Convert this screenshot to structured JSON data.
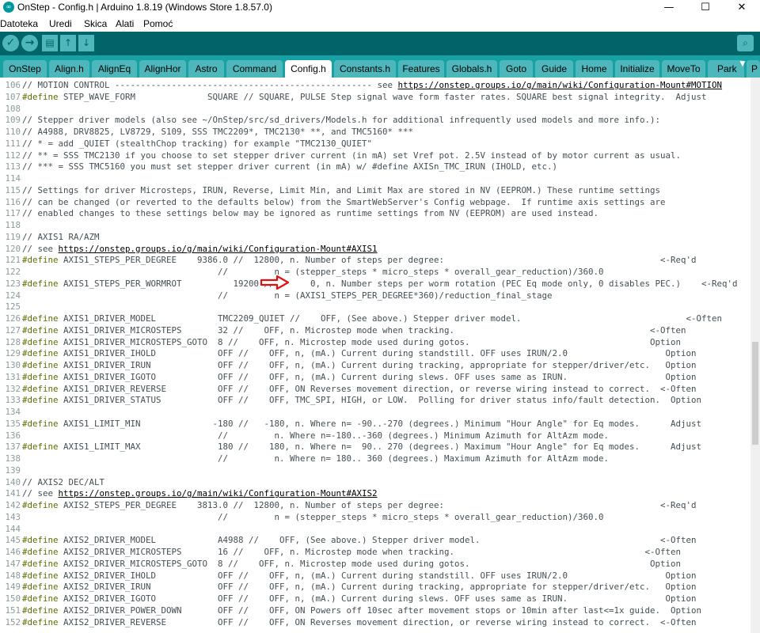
{
  "window": {
    "title": "OnStep - Config.h | Arduino 1.8.19 (Windows Store 1.8.57.0)",
    "app_icon_text": "∞",
    "minimize": "—",
    "maximize": "☐",
    "close": "✕"
  },
  "menu": [
    "Datoteka",
    "Uredi",
    "Skica",
    "Alati",
    "Pomoć"
  ],
  "toolbar": {
    "verify_icon": "✓",
    "upload_icon": "→",
    "new_icon": "▤",
    "open_icon": "↑",
    "save_icon": "↓",
    "serial_icon": "⌕"
  },
  "tabs": [
    {
      "label": "OnStep",
      "active": false
    },
    {
      "label": "Align.h",
      "active": false
    },
    {
      "label": "AlignEq",
      "active": false
    },
    {
      "label": "AlignHor",
      "active": false
    },
    {
      "label": "Astro",
      "active": false
    },
    {
      "label": "Command",
      "active": false
    },
    {
      "label": "Config.h",
      "active": true
    },
    {
      "label": "Constants.h",
      "active": false
    },
    {
      "label": "Features",
      "active": false
    },
    {
      "label": "Globals.h",
      "active": false
    },
    {
      "label": "Goto",
      "active": false
    },
    {
      "label": "Guide",
      "active": false
    },
    {
      "label": "Home",
      "active": false
    },
    {
      "label": "Initialize",
      "active": false
    },
    {
      "label": "MoveTo",
      "active": false
    },
    {
      "label": "Park",
      "active": false
    },
    {
      "label": "P",
      "active": false
    }
  ],
  "tab_menu_icon": "▼",
  "code_lines": [
    {
      "n": "106",
      "t": "// MOTION CONTROL -------------------------------------------------- see [[https://onstep.groups.io/g/main/wiki/Configuration-Mount#MOTION]]"
    },
    {
      "n": "107",
      "t": "{{#define}} STEP_WAVE_FORM              SQUARE // SQUARE, PULSE Step signal wave form faster rates. SQUARE best signal integrity.  Adjust"
    },
    {
      "n": "108",
      "t": ""
    },
    {
      "n": "109",
      "t": "// Stepper driver models (also see ~/OnStep/src/sd_drivers/Models.h for additional infrequently used models and more info.):"
    },
    {
      "n": "110",
      "t": "// A4988, DRV8825, LV8729, S109, SSS TMC2209*, TMC2130* **, and TMC5160* ***"
    },
    {
      "n": "111",
      "t": "// * = add _QUIET (stealthChop tracking) for example \"TMC2130_QUIET\""
    },
    {
      "n": "112",
      "t": "// ** = SSS TMC2130 if you choose to set stepper driver current (in mA) set Vref pot. 2.5V instead of by motor current as usual."
    },
    {
      "n": "113",
      "t": "// *** = SSS TMC5160 you must set stepper driver current (in mA) w/ #define AXISn_TMC_IRUN (IHOLD, etc.)"
    },
    {
      "n": "114",
      "t": ""
    },
    {
      "n": "115",
      "t": "// Settings for driver Microsteps, IRUN, Reverse, Limit Min, and Limit Max are stored in NV (EEPROM.) These runtime settings"
    },
    {
      "n": "116",
      "t": "// can be changed (or reverted to the defaults below) from the SmartWebServer's Config webpage.  If runtime axis settings are"
    },
    {
      "n": "117",
      "t": "// enabled changes to these settings below may be ignored as runtime settings from NV (EEPROM) are used instead."
    },
    {
      "n": "118",
      "t": ""
    },
    {
      "n": "119",
      "t": "// AXIS1 RA/AZM"
    },
    {
      "n": "120",
      "t": "// see [[https://onstep.groups.io/g/main/wiki/Configuration-Mount#AXIS1]]"
    },
    {
      "n": "121",
      "t": "{{#define}} AXIS1_STEPS_PER_DEGREE    9386.0 //  12800, n. Number of steps per degree:                                          <-Req'd"
    },
    {
      "n": "122",
      "t": "                                      //         n = (stepper_steps * micro_steps * overall_gear_reduction)/360.0"
    },
    {
      "n": "123",
      "t": "{{#define}} AXIS1_STEPS_PER_WORMROT          19200 //       0, n. Number steps per worm rotation (PEC Eq mode only, 0 disables PEC.)    <-Req'd"
    },
    {
      "n": "124",
      "t": "                                      //         n = (AXIS1_STEPS_PER_DEGREE*360)/reduction_final_stage"
    },
    {
      "n": "125",
      "t": ""
    },
    {
      "n": "126",
      "t": "{{#define}} AXIS1_DRIVER_MODEL            TMC2209_QUIET //    OFF, (See above.) Stepper driver model.                                <-Often"
    },
    {
      "n": "127",
      "t": "{{#define}} AXIS1_DRIVER_MICROSTEPS       32 //    OFF, n. Microstep mode when tracking.                                      <-Often"
    },
    {
      "n": "128",
      "t": "{{#define}} AXIS1_DRIVER_MICROSTEPS_GOTO  8 //    OFF, n. Microstep mode used during gotos.                                   Option"
    },
    {
      "n": "129",
      "t": "{{#define}} AXIS1_DRIVER_IHOLD            OFF //    OFF, n, (mA.) Current during standstill. OFF uses IRUN/2.0                   Option"
    },
    {
      "n": "130",
      "t": "{{#define}} AXIS1_DRIVER_IRUN             OFF //    OFF, n, (mA.) Current during tracking, appropriate for stepper/driver/etc.   Option"
    },
    {
      "n": "131",
      "t": "{{#define}} AXIS1_DRIVER_IGOTO            OFF //    OFF, n, (mA.) Current during slews. OFF uses same as IRUN.                   Option"
    },
    {
      "n": "132",
      "t": "{{#define}} AXIS1_DRIVER_REVERSE          OFF //    OFF, ON Reverses movement direction, or reverse wiring instead to correct.  <-Often"
    },
    {
      "n": "133",
      "t": "{{#define}} AXIS1_DRIVER_STATUS           OFF //    OFF, TMC_SPI, HIGH, or LOW.  Polling for driver status info/fault detection.  Option"
    },
    {
      "n": "134",
      "t": ""
    },
    {
      "n": "135",
      "t": "{{#define}} AXIS1_LIMIT_MIN              -180 //   -180, n. Where n= -90..-270 (degrees.) Minimum \"Hour Angle\" for Eq modes.      Adjust"
    },
    {
      "n": "136",
      "t": "                                      //         n. Where n=-180..-360 (degrees.) Minimum Azimuth for AltAzm mode."
    },
    {
      "n": "137",
      "t": "{{#define}} AXIS1_LIMIT_MAX               180 //    180, n. Where n=  90.. 270 (degrees.) Maximum \"Hour Angle\" for Eq modes.      Adjust"
    },
    {
      "n": "138",
      "t": "                                      //         n. Where n= 180.. 360 (degrees.) Maximum Azimuth for AltAzm mode."
    },
    {
      "n": "139",
      "t": ""
    },
    {
      "n": "140",
      "t": "// AXIS2 DEC/ALT"
    },
    {
      "n": "141",
      "t": "// see [[https://onstep.groups.io/g/main/wiki/Configuration-Mount#AXIS2]]"
    },
    {
      "n": "142",
      "t": "{{#define}} AXIS2_STEPS_PER_DEGREE    3813.0 //  12800, n. Number of steps per degree:                                          <-Req'd"
    },
    {
      "n": "143",
      "t": "                                      //         n = (stepper_steps * micro_steps * overall_gear_reduction)/360.0"
    },
    {
      "n": "144",
      "t": ""
    },
    {
      "n": "145",
      "t": "{{#define}} AXIS2_DRIVER_MODEL            A4988 //    OFF, (See above.) Stepper driver model.                                   <-Often"
    },
    {
      "n": "146",
      "t": "{{#define}} AXIS2_DRIVER_MICROSTEPS       16 //    OFF, n. Microstep mode when tracking.                                     <-Often"
    },
    {
      "n": "147",
      "t": "{{#define}} AXIS2_DRIVER_MICROSTEPS_GOTO  8 //    OFF, n. Microstep mode used during gotos.                                   Option"
    },
    {
      "n": "148",
      "t": "{{#define}} AXIS2_DRIVER_IHOLD            OFF //    OFF, n, (mA.) Current during standstill. OFF uses IRUN/2.0                   Option"
    },
    {
      "n": "149",
      "t": "{{#define}} AXIS2_DRIVER_IRUN             OFF //    OFF, n, (mA.) Current during tracking, appropriate for stepper/driver/etc.   Option"
    },
    {
      "n": "150",
      "t": "{{#define}} AXIS2_DRIVER_IGOTO            OFF //    OFF, n, (mA.) Current during slews. OFF uses same as IRUN.                   Option"
    },
    {
      "n": "151",
      "t": "{{#define}} AXIS2_DRIVER_POWER_DOWN       OFF //    OFF, ON Powers off 10sec after movement stops or 10min after last<=1x guide.  Option"
    },
    {
      "n": "152",
      "t": "{{#define}} AXIS2_DRIVER_REVERSE          OFF //    OFF, ON Reverses movement direction, or reverse wiring instead to correct.  <-Often"
    }
  ],
  "annotation": "red-arrow"
}
